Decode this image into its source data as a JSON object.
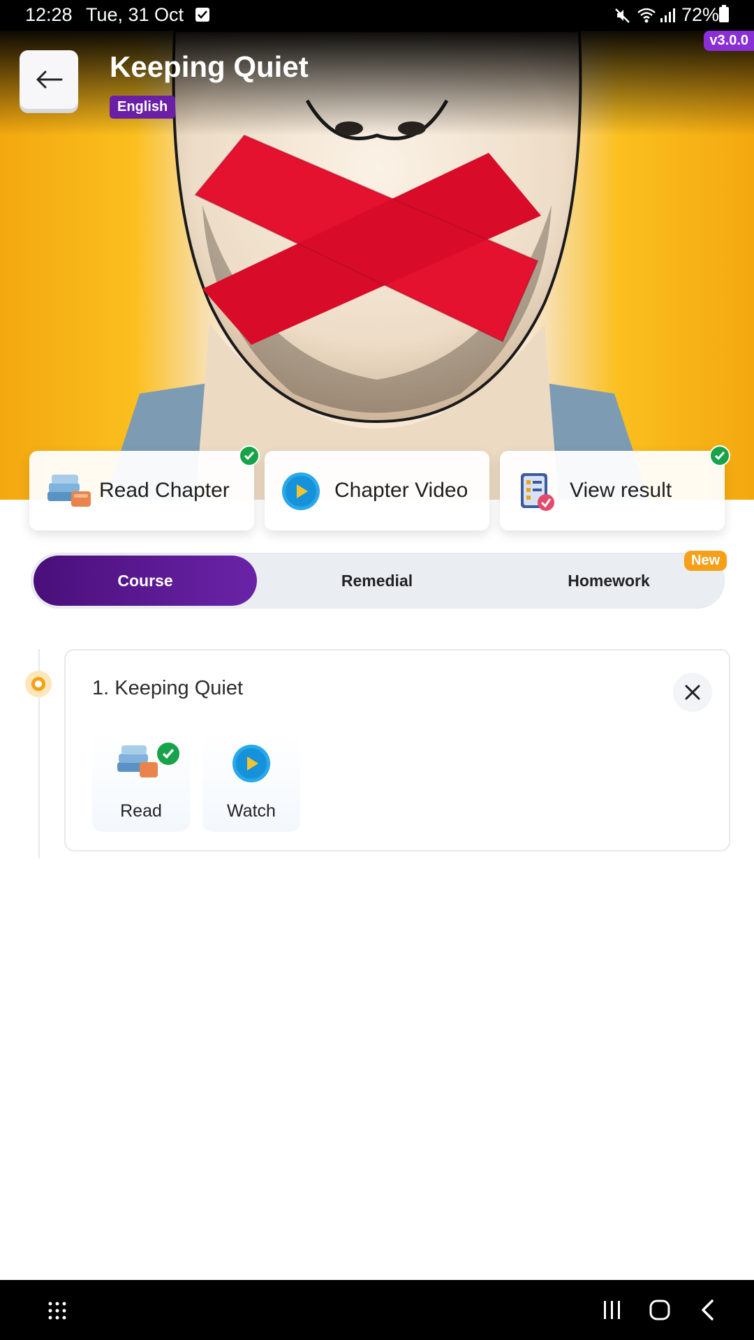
{
  "status_bar": {
    "time": "12:28",
    "date": "Tue, 31 Oct",
    "battery": "72%",
    "icons": [
      "notification-check-icon",
      "mute-icon",
      "wifi-icon",
      "signal-icon",
      "battery-icon"
    ]
  },
  "app": {
    "version": "v3.0.0"
  },
  "header": {
    "title": "Keeping Quiet",
    "language": "English"
  },
  "actions": [
    {
      "label": "Read Chapter",
      "icon": "books-icon",
      "completed": true
    },
    {
      "label": "Chapter Video",
      "icon": "play-icon",
      "completed": false
    },
    {
      "label": "View result",
      "icon": "result-icon",
      "completed": true
    }
  ],
  "tabs": [
    {
      "label": "Course",
      "active": true
    },
    {
      "label": "Remedial",
      "active": false
    },
    {
      "label": "Homework",
      "active": false,
      "badge": "New"
    }
  ],
  "lesson": {
    "title": "1. Keeping Quiet",
    "items": [
      {
        "label": "Read",
        "icon": "books-icon",
        "completed": true
      },
      {
        "label": "Watch",
        "icon": "play-icon",
        "completed": false
      }
    ]
  },
  "colors": {
    "primary": "#4a0f7a",
    "accent": "#f6a01a",
    "success": "#17a34a",
    "hero_bg": "#fbbf1f",
    "tape_red": "#e4112f"
  }
}
